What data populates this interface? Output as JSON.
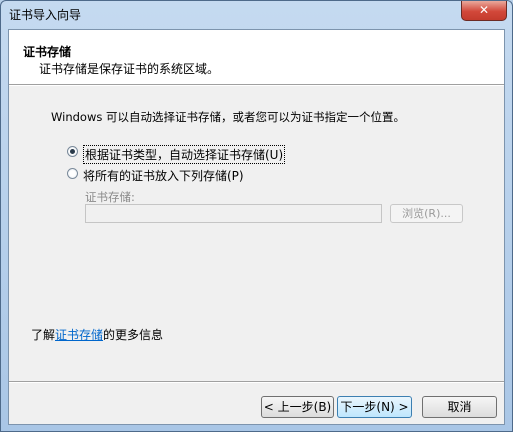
{
  "window": {
    "title": "证书导入向导",
    "close_glyph": "✕"
  },
  "header": {
    "title": "证书存储",
    "subtitle": "证书存储是保存证书的系统区域。"
  },
  "description": "Windows 可以自动选择证书存储，或者您可以为证书指定一个位置。",
  "options": [
    {
      "label": "根据证书类型，自动选择证书存储(U)",
      "checked": true
    },
    {
      "label": "将所有的证书放入下列存储(P)",
      "checked": false
    }
  ],
  "store": {
    "label": "证书存储:",
    "value": "",
    "browse_label": "浏览(R)..."
  },
  "learn_more": {
    "prefix": "了解",
    "link": "证书存储",
    "suffix": "的更多信息"
  },
  "buttons": {
    "back": "< 上一步(B)",
    "next": "下一步(N) >",
    "cancel": "取消"
  },
  "colors": {
    "link": "#0066cc",
    "close": "#c43b2d",
    "title_bar": "#b9d1ea"
  }
}
